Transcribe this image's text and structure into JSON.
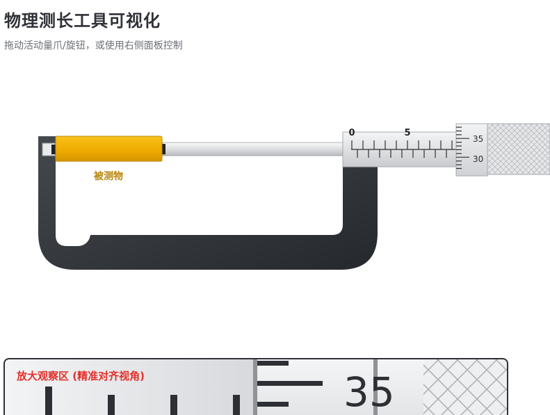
{
  "header": {
    "title": "物理测长工具可视化",
    "subtitle": "拖动活动量爪/旋钮，或使用右侧面板控制"
  },
  "micrometer": {
    "object_label": "被测物",
    "sleeve_labels": [
      "0",
      "5"
    ],
    "thimble_labels": [
      "35",
      "30"
    ]
  },
  "zoom_panel": {
    "title": "放大观察区 (精准对齐视角)",
    "thimble_number": "35"
  },
  "colors": {
    "frame_dark": "#2c2f33",
    "object_gold": "#f0b400",
    "object_label": "#b8860b",
    "zoom_title": "#e0312b"
  }
}
